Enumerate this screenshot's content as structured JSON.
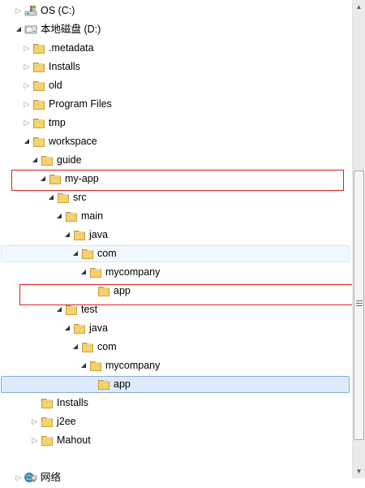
{
  "tree": [
    {
      "label": "OS (C:)",
      "depth": 1,
      "arrow": "collapsed",
      "icon": "drive-windows-icon"
    },
    {
      "label": "本地磁盘 (D:)",
      "depth": 1,
      "arrow": "expanded",
      "icon": "drive-local-icon"
    },
    {
      "label": ".metadata",
      "depth": 2,
      "arrow": "collapsed",
      "icon": "folder-icon"
    },
    {
      "label": "Installs",
      "depth": 2,
      "arrow": "collapsed",
      "icon": "folder-icon"
    },
    {
      "label": "old",
      "depth": 2,
      "arrow": "collapsed",
      "icon": "folder-icon"
    },
    {
      "label": "Program Files",
      "depth": 2,
      "arrow": "collapsed",
      "icon": "folder-icon"
    },
    {
      "label": "tmp",
      "depth": 2,
      "arrow": "collapsed",
      "icon": "folder-icon"
    },
    {
      "label": "workspace",
      "depth": 2,
      "arrow": "expanded",
      "icon": "folder-icon"
    },
    {
      "label": "guide",
      "depth": 3,
      "arrow": "expanded",
      "icon": "folder-icon"
    },
    {
      "label": "my-app",
      "depth": 4,
      "arrow": "expanded",
      "icon": "folder-icon"
    },
    {
      "label": "src",
      "depth": 5,
      "arrow": "expanded",
      "icon": "folder-icon"
    },
    {
      "label": "main",
      "depth": 6,
      "arrow": "expanded",
      "icon": "folder-icon"
    },
    {
      "label": "java",
      "depth": 7,
      "arrow": "expanded",
      "icon": "folder-icon"
    },
    {
      "label": "com",
      "depth": 8,
      "arrow": "expanded",
      "icon": "folder-icon",
      "state": "hover"
    },
    {
      "label": "mycompany",
      "depth": 9,
      "arrow": "expanded",
      "icon": "folder-icon"
    },
    {
      "label": "app",
      "depth": 10,
      "arrow": "none",
      "icon": "folder-icon"
    },
    {
      "label": "test",
      "depth": 6,
      "arrow": "expanded",
      "icon": "folder-icon"
    },
    {
      "label": "java",
      "depth": 7,
      "arrow": "expanded",
      "icon": "folder-icon"
    },
    {
      "label": "com",
      "depth": 8,
      "arrow": "expanded",
      "icon": "folder-icon"
    },
    {
      "label": "mycompany",
      "depth": 9,
      "arrow": "expanded",
      "icon": "folder-icon"
    },
    {
      "label": "app",
      "depth": 10,
      "arrow": "none",
      "icon": "folder-icon",
      "state": "selected"
    },
    {
      "label": "Installs",
      "depth": 3,
      "arrow": "none",
      "icon": "folder-icon"
    },
    {
      "label": "j2ee",
      "depth": 3,
      "arrow": "collapsed",
      "icon": "folder-icon"
    },
    {
      "label": "Mahout",
      "depth": 3,
      "arrow": "collapsed",
      "icon": "folder-icon"
    },
    {
      "label": "网络",
      "depth": 1,
      "arrow": "collapsed",
      "icon": "network-icon"
    }
  ],
  "highlights": [
    "my-app",
    "app"
  ],
  "colors": {
    "highlight_border": "#d9211d",
    "selected_bg": "#dceafa",
    "selected_border": "#84acdd",
    "hover_bg": "#f2f8fd",
    "folder_yellow": "#f2c94c"
  },
  "scrollbar": {
    "up_icon": "scroll-up-arrow-icon",
    "down_icon": "scroll-down-arrow-icon",
    "grip_icon": "scroll-grip-icon"
  }
}
